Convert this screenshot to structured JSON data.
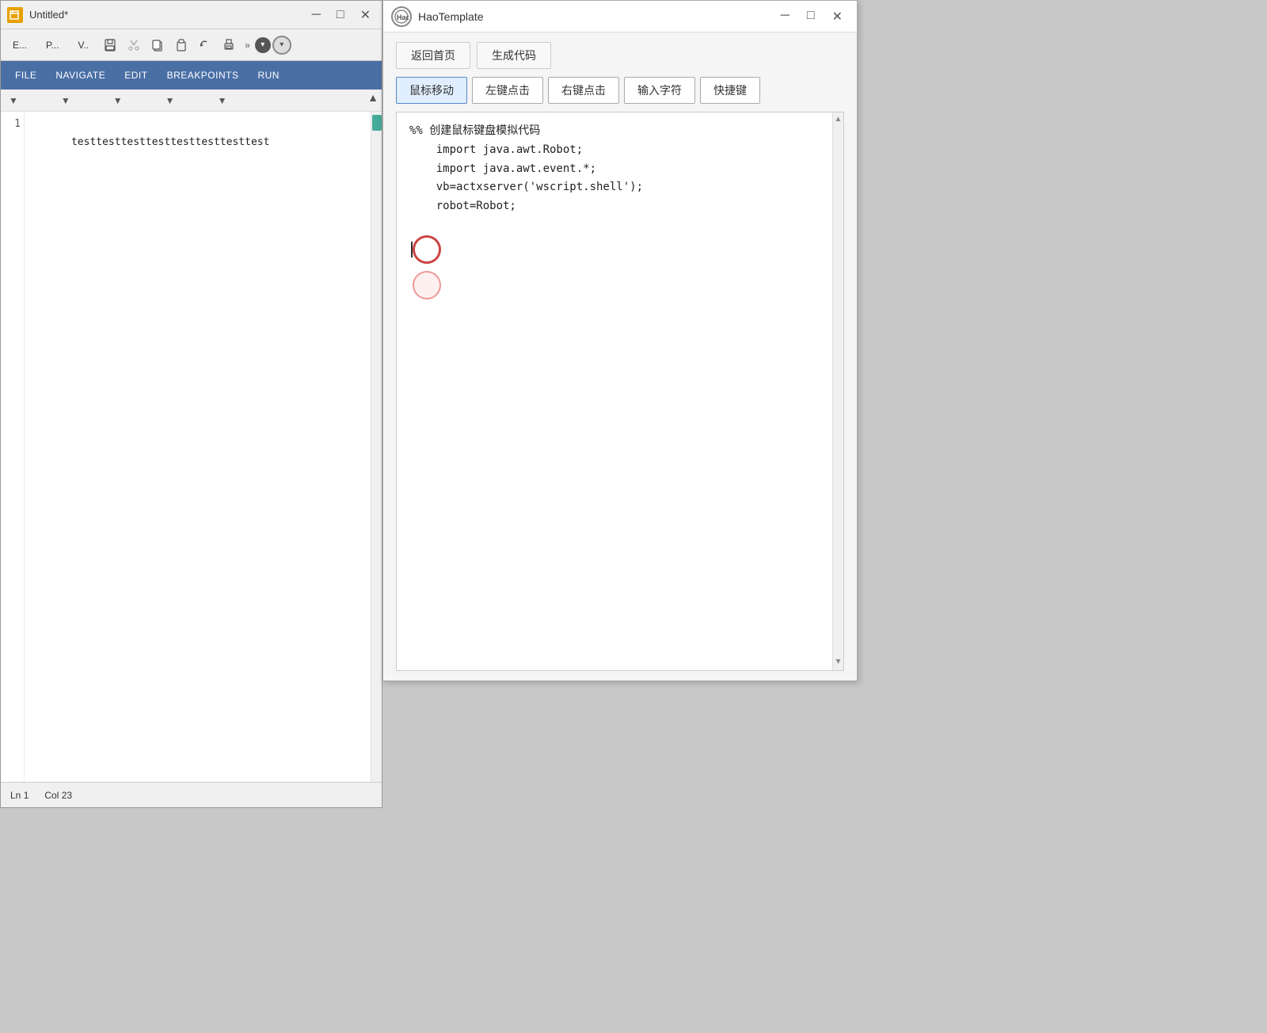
{
  "editor": {
    "title": "Untitled*",
    "toolbar_tabs": [
      "E...",
      "P...",
      "V.."
    ],
    "toolbar_icons": [
      "save",
      "cut",
      "copy",
      "paste",
      "undo",
      "print"
    ],
    "menu_items": [
      "FILE",
      "NAVIGATE",
      "EDIT",
      "BREAKPOINTS",
      "RUN"
    ],
    "line_number": "1",
    "code_content": "testtesttesttesttesttesttesttest",
    "status_ln": "Ln",
    "status_ln_val": "1",
    "status_col": "Col",
    "status_col_val": "23"
  },
  "hao": {
    "title": "HaoTemplate",
    "top_buttons": {
      "back": "返回首页",
      "generate": "生成代码"
    },
    "nav_buttons": [
      "鼠标移动",
      "左键点击",
      "右键点击",
      "输入字符",
      "快捷键"
    ],
    "active_nav": "鼠标移动",
    "code": {
      "comment": "%% 创建鼠标键盘模拟代码",
      "line1": "    import java.awt.Robot;",
      "line2": "    import java.awt.event.*;",
      "line3": "    vb=actxserver('wscript.shell');",
      "line4": "    robot=Robot;"
    }
  }
}
